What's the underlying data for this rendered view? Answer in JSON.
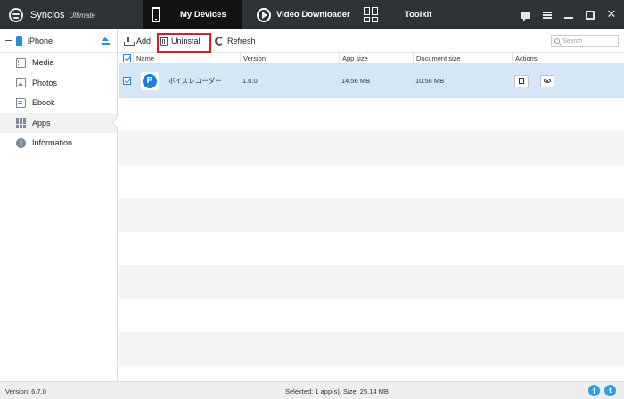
{
  "app": {
    "name": "Syncios",
    "edition": "Ultimate"
  },
  "nav_tabs": [
    {
      "label": "My Devices",
      "icon": "phone-icon",
      "active": true
    },
    {
      "label": "Video Downloader",
      "icon": "play-icon",
      "active": false
    },
    {
      "label": "Toolkit",
      "icon": "toolkit-grid-icon",
      "active": false
    }
  ],
  "window_controls": [
    "feedback-icon",
    "menu-icon",
    "minimize-icon",
    "maximize-icon",
    "close-icon"
  ],
  "sidebar": {
    "device": "iPhone",
    "items": [
      {
        "label": "Media",
        "icon": "media-icon",
        "active": false
      },
      {
        "label": "Photos",
        "icon": "photos-icon",
        "active": false
      },
      {
        "label": "Ebook",
        "icon": "ebook-icon",
        "active": false
      },
      {
        "label": "Apps",
        "icon": "apps-icon",
        "active": true
      },
      {
        "label": "Information",
        "icon": "information-icon",
        "active": false
      }
    ]
  },
  "toolbar": {
    "add_label": "Add",
    "uninstall_label": "Uninstall",
    "refresh_label": "Refresh",
    "search_placeholder": "Search"
  },
  "table": {
    "columns": [
      "Name",
      "Version",
      "App size",
      "Document size",
      "Actions"
    ],
    "rows": [
      {
        "name": "ボイスレコーダー",
        "version": "1.0.0",
        "app_size": "14.56 MB",
        "doc_size": "10.58 MB",
        "checked": true,
        "selected": true
      }
    ]
  },
  "status": {
    "version": "Version: 6.7.0",
    "selected": "Selected: 1 app(s), Size: 25.14 MB"
  },
  "colors": {
    "titlebar": "#2e3338",
    "active_tab": "#101214",
    "accent_blue": "#1e90d8",
    "highlight_red": "#d81f26",
    "selected_row": "#d5e6f7"
  }
}
